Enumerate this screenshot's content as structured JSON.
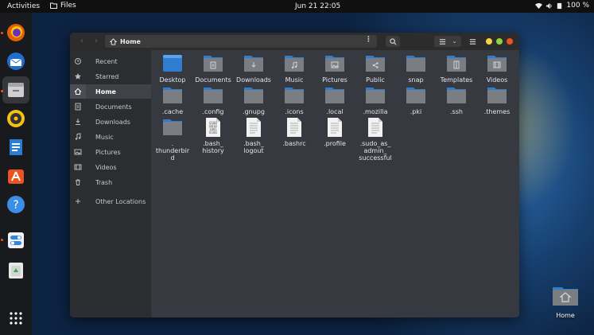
{
  "topbar": {
    "activities": "Activities",
    "app": "Files",
    "clock": "Jun 21  22:05",
    "battery": "100 %"
  },
  "dock": {
    "apps": [
      "firefox",
      "thunderbird",
      "files",
      "rhythmbox",
      "libreoffice-writer",
      "software",
      "help",
      "settings",
      "trash"
    ],
    "show_apps": "show-applications"
  },
  "desktop": {
    "home_label": "Home"
  },
  "window": {
    "path": "Home",
    "sidebar": [
      {
        "label": "Recent",
        "icon": "clock-icon"
      },
      {
        "label": "Starred",
        "icon": "star-icon"
      },
      {
        "label": "Home",
        "icon": "home-icon"
      },
      {
        "label": "Documents",
        "icon": "document-icon"
      },
      {
        "label": "Downloads",
        "icon": "download-icon"
      },
      {
        "label": "Music",
        "icon": "music-icon"
      },
      {
        "label": "Pictures",
        "icon": "picture-icon"
      },
      {
        "label": "Videos",
        "icon": "video-icon"
      },
      {
        "label": "Trash",
        "icon": "trash-icon"
      },
      {
        "label": "Other Locations",
        "icon": "plus-icon"
      }
    ],
    "files": [
      {
        "name": "Desktop",
        "kind": "desktop"
      },
      {
        "name": "Documents",
        "kind": "folder-doc"
      },
      {
        "name": "Downloads",
        "kind": "folder-down"
      },
      {
        "name": "Music",
        "kind": "folder-music"
      },
      {
        "name": "Pictures",
        "kind": "folder-pic"
      },
      {
        "name": "Public",
        "kind": "folder-share"
      },
      {
        "name": "snap",
        "kind": "folder"
      },
      {
        "name": "Templates",
        "kind": "folder-tpl"
      },
      {
        "name": "Videos",
        "kind": "folder-video"
      },
      {
        "name": ".cache",
        "kind": "folder"
      },
      {
        "name": ".config",
        "kind": "folder"
      },
      {
        "name": ".gnupg",
        "kind": "folder"
      },
      {
        "name": ".icons",
        "kind": "folder"
      },
      {
        "name": ".local",
        "kind": "folder"
      },
      {
        "name": ".mozilla",
        "kind": "folder"
      },
      {
        "name": ".pki",
        "kind": "folder"
      },
      {
        "name": ".ssh",
        "kind": "folder"
      },
      {
        "name": ".themes",
        "kind": "folder"
      },
      {
        "name": ".\nthunderbir\nd",
        "kind": "folder"
      },
      {
        "name": ".bash_\nhistory",
        "kind": "binary"
      },
      {
        "name": ".bash_\nlogout",
        "kind": "text"
      },
      {
        "name": ".bashrc",
        "kind": "text"
      },
      {
        "name": ".profile",
        "kind": "text"
      },
      {
        "name": ".sudo_as_\nadmin_\nsuccessful",
        "kind": "text"
      }
    ]
  },
  "colors": {
    "folder": "#7a7d82",
    "folder_tab": "#2f7dd1",
    "accent": "#e95420",
    "win_close": "#e95420",
    "win_max": "#8ed43f",
    "win_min": "#f5d04b"
  }
}
